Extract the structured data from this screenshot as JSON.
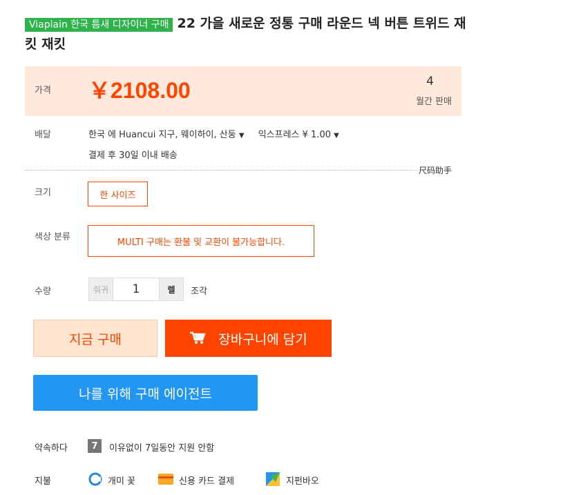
{
  "product": {
    "shop_badge": "Viaplain 한국 틈새 디자이너 구매",
    "title": "22 가을 새로운 정통 구매 라운드 넥 버튼 트위드 재킷 재킷"
  },
  "price_section": {
    "label": "가격",
    "price": "￥2108.00",
    "monthly_sales_count": "4",
    "monthly_sales_label": "월간 판매"
  },
  "shipping": {
    "label": "배달",
    "location": "한국 에 Huancui 지구, 웨이하이, 산둥",
    "method": "익스프레스 ¥ 1.00",
    "delivery_note": "결제 후 30일 이내 배송"
  },
  "size_helper": "尺码助手",
  "size": {
    "label": "크기",
    "option": "한 사이즈"
  },
  "color": {
    "label": "색상 분류",
    "option": "MULTI 구매는 환불 및 교환이 불가능합니다."
  },
  "quantity": {
    "label": "수량",
    "decrement": "줘귀",
    "value": "1",
    "increment": "렐",
    "unit": "조각"
  },
  "buttons": {
    "buy_now": "지금 구매",
    "add_to_cart": "장바구니에 담기",
    "agent": "나를 위해 구매 에이전트"
  },
  "promise": {
    "label": "약속하다",
    "badge": "7",
    "text": "이유없이 7일동안 지원 안함"
  },
  "payment": {
    "label": "지불",
    "methods": [
      "개미 꽃",
      "신용 카드 결제",
      "지펀바오"
    ]
  },
  "colors": {
    "accent": "#ff4400",
    "agent_blue": "#2196f3",
    "shop_green": "#2db34a"
  }
}
